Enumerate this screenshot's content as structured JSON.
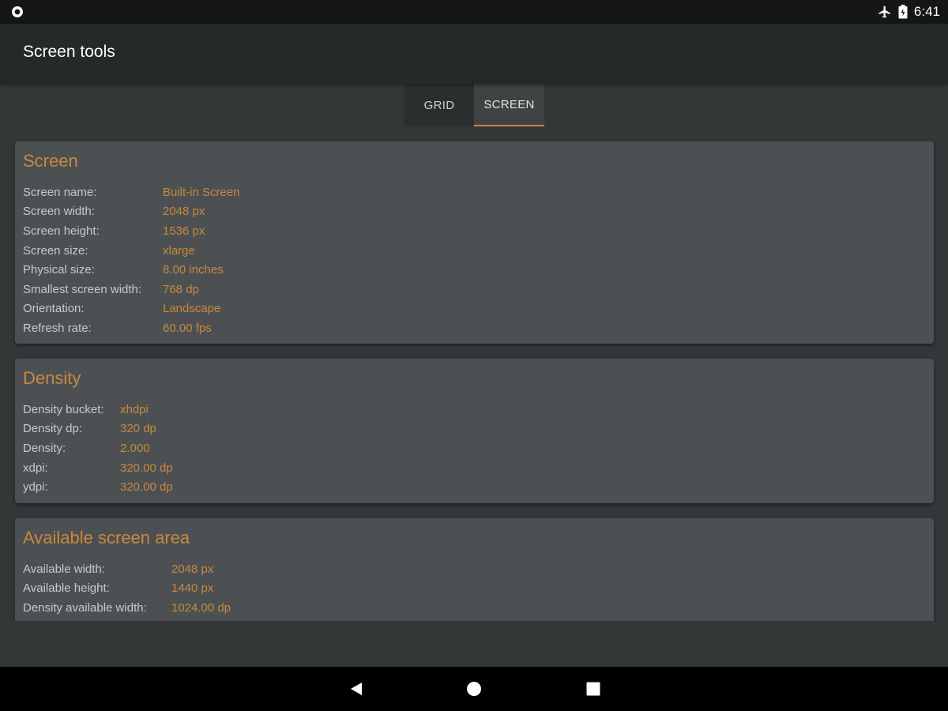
{
  "status_bar": {
    "time": "6:41",
    "icons": [
      "record-icon",
      "airplane-mode-icon",
      "battery-icon"
    ]
  },
  "app_bar": {
    "title": "Screen tools"
  },
  "tabs": [
    {
      "label": "GRID",
      "selected": false
    },
    {
      "label": "SCREEN",
      "selected": true
    }
  ],
  "colors": {
    "accent": "#c8893f",
    "card": "#4c5052",
    "background": "#343738",
    "app_bar": "#26292a"
  },
  "screen_card": {
    "title": "Screen",
    "rows": [
      {
        "label": "Screen name:",
        "value": "Built-in Screen"
      },
      {
        "label": "Screen width:",
        "value": "2048 px"
      },
      {
        "label": "Screen height:",
        "value": "1536 px"
      },
      {
        "label": "Screen size:",
        "value": "xlarge"
      },
      {
        "label": "Physical size:",
        "value": "8.00 inches"
      },
      {
        "label": "Smallest screen width:",
        "value": "768 dp"
      },
      {
        "label": "Orientation:",
        "value": "Landscape"
      },
      {
        "label": "Refresh rate:",
        "value": "60.00 fps"
      }
    ]
  },
  "density_card": {
    "title": "Density",
    "rows": [
      {
        "label": "Density bucket:",
        "value": "xhdpi"
      },
      {
        "label": "Density dp:",
        "value": "320 dp"
      },
      {
        "label": "Density:",
        "value": "2.000"
      },
      {
        "label": "xdpi:",
        "value": "320.00 dp"
      },
      {
        "label": "ydpi:",
        "value": "320.00 dp"
      }
    ]
  },
  "area_card": {
    "title": "Available screen area",
    "rows": [
      {
        "label": "Available width:",
        "value": "2048 px"
      },
      {
        "label": "Available height:",
        "value": "1440 px"
      },
      {
        "label": "Density available width:",
        "value": "1024.00 dp"
      }
    ]
  },
  "nav_bar": {
    "buttons": [
      "back-icon",
      "home-icon",
      "recents-icon"
    ]
  }
}
